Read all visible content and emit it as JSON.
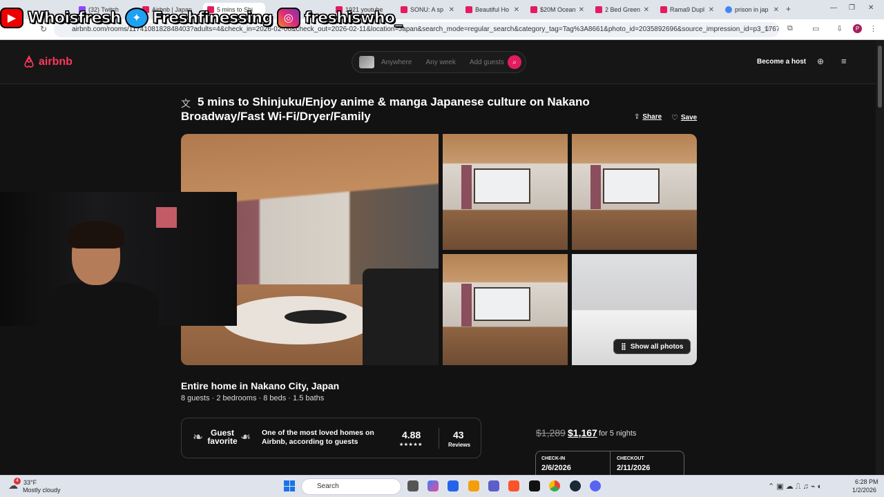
{
  "browser": {
    "tabs": [
      {
        "label": "(32) Twitch"
      },
      {
        "label": "Airbnb | Japan"
      },
      {
        "label": "5 mins to Shi"
      },
      {
        "label": "1921 youtube"
      },
      {
        "label": "SONU: A sp"
      },
      {
        "label": "Beautiful Ho"
      },
      {
        "label": "$20M Ocean"
      },
      {
        "label": "2 Bed Green"
      },
      {
        "label": "Rama9 Dupl"
      },
      {
        "label": "prison in jap"
      }
    ],
    "url": "airbnb.com/rooms/1174108182848403?adults=4&check_in=2026-02-06&check_out=2026-02-11&location=Japan&search_mode=regular_search&category_tag=Tag%3A8661&photo_id=2035892696&source_impression_id=p3_1767396..."
  },
  "overlay": {
    "youtube": "Whoisfresh",
    "twitter": "Freshfinessing",
    "instagram": "freshiswho_"
  },
  "header": {
    "logo": "airbnb",
    "search_where": "Anywhere",
    "search_when": "Any week",
    "search_who": "Add guests",
    "become_host": "Become a host"
  },
  "listing": {
    "title": "5 mins to Shinjuku/Enjoy anime & manga Japanese culture on Nakano Broadway/Fast Wi-Fi/Dryer/Family",
    "share": "Share",
    "save": "Save",
    "show_all_photos": "Show all photos",
    "type": "Entire home in Nakano City, Japan",
    "summary": "8 guests · 2 bedrooms · 8 beds · 1.5 baths",
    "guest_favorite": "Guest favorite",
    "gf_description": "One of the most loved homes on Airbnb, according to guests",
    "rating": "4.88",
    "stars": "★★★★★",
    "reviews_count": "43",
    "reviews_label": "Reviews"
  },
  "booking": {
    "price_original": "$1,289",
    "price_discounted": "$1,167",
    "price_suffix": "for 5 nights",
    "checkin_label": "CHECK-IN",
    "checkin_value": "2/6/2026",
    "checkout_label": "CHECKOUT",
    "checkout_value": "2/11/2026"
  },
  "taskbar": {
    "weather_temp": "33°F",
    "weather_desc": "Mostly cloudy",
    "weather_badge": "4",
    "search": "Search",
    "time": "6:28 PM",
    "date": "1/2/2026"
  },
  "colors": {
    "brand": "#ff385c",
    "search_button": "#e31c5f",
    "background": "#121212"
  }
}
